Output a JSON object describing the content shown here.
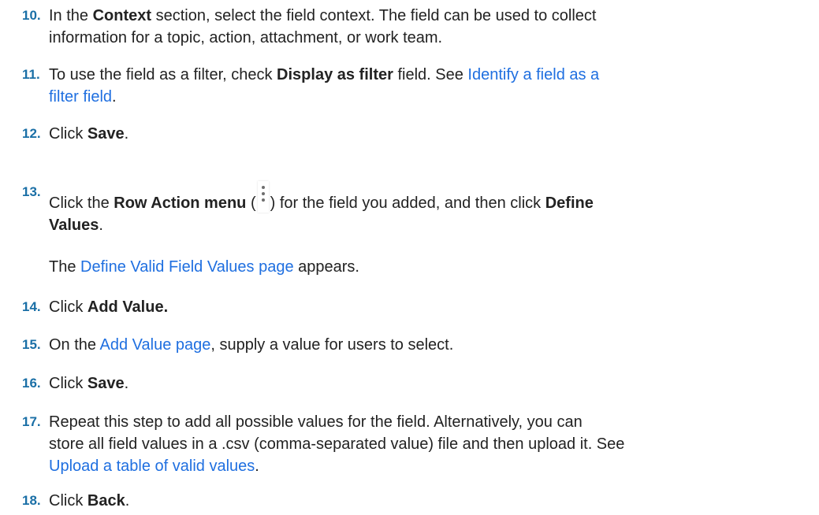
{
  "steps": {
    "s10": {
      "num": "10.",
      "l1_a": "In the ",
      "l1_b": "Context",
      "l1_c": " section, select the field context. The field can be used to collect",
      "l2": "information for a topic, action, attachment, or work team."
    },
    "s11": {
      "num": "11.",
      "l1_a": "To use the field as a filter, check ",
      "l1_b": "Display as filter",
      "l1_c": " field. See ",
      "l1_link": "Identify a field as a",
      "l2_link": "filter field",
      "l2_end": "."
    },
    "s12": {
      "num": "12.",
      "a": "Click ",
      "b": "Save",
      "c": "."
    },
    "s13": {
      "num": "13.",
      "l1_a": "Click the ",
      "l1_b": "Row Action menu",
      "l1_c": " (",
      "l1_d": ") for the field you added, and then click ",
      "l1_e": "Define",
      "l2_b": "Values",
      "l2_c": ".",
      "sub_a": "The ",
      "sub_link": "Define Valid Field Values page",
      "sub_c": " appears.",
      "icon": "vertical-ellipsis-icon"
    },
    "s14": {
      "num": "14.",
      "a": "Click ",
      "b": "Add Value."
    },
    "s15": {
      "num": "15.",
      "a": "On the ",
      "link": "Add Value page",
      "c": ", supply a value for users to select."
    },
    "s16": {
      "num": "16.",
      "a": "Click ",
      "b": "Save",
      "c": "."
    },
    "s17": {
      "num": "17.",
      "l1": "Repeat this step to add all possible values for the field. Alternatively, you can",
      "l2": "store all field values in a .csv (comma-separated value) file and then upload it. See",
      "l3_link": "Upload a table of valid values",
      "l3_end": "."
    },
    "s18": {
      "num": "18.",
      "a": "Click ",
      "b": "Back",
      "c": "."
    }
  }
}
